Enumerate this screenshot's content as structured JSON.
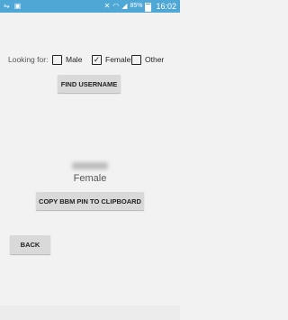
{
  "status_bar": {
    "left_icons": [
      "usb-debug-icon",
      "notification-icon"
    ],
    "right_icons": [
      "mute-icon",
      "wifi-icon",
      "signal-icon"
    ],
    "battery": "85%",
    "time": "16:02",
    "color": "#4fa7d6"
  },
  "filter": {
    "label": "Looking for:",
    "options": [
      {
        "label": "Male",
        "checked": false
      },
      {
        "label": "Female",
        "checked": true
      },
      {
        "label": "Other",
        "checked": false
      }
    ]
  },
  "buttons": {
    "find": "FIND USERNAME",
    "copy": "COPY BBM PIN TO CLIPBOARD",
    "back": "BACK"
  },
  "result": {
    "gender": "Female"
  }
}
